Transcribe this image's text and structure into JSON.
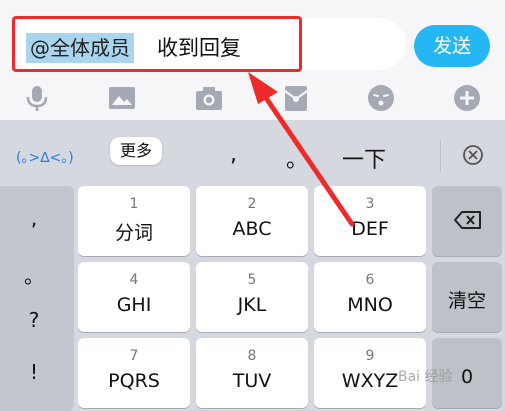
{
  "input": {
    "mention": "@全体成员",
    "text": "收到回复"
  },
  "send_button": {
    "label": "发送"
  },
  "toolbar_icons": [
    "microphone-icon",
    "image-icon",
    "camera-icon",
    "red-packet-icon",
    "emoji-icon",
    "plus-icon"
  ],
  "suggestion_bar": {
    "emoticon": "(｡>∆<｡)",
    "more_label": "更多",
    "candidates": [
      ",",
      "。",
      "一下"
    ]
  },
  "punctuation_keys": [
    ",",
    "。",
    "?",
    "!"
  ],
  "keys": [
    {
      "num": "1",
      "letters": "分词"
    },
    {
      "num": "2",
      "letters": "ABC"
    },
    {
      "num": "3",
      "letters": "DEF"
    },
    {
      "num": "4",
      "letters": "GHI"
    },
    {
      "num": "5",
      "letters": "JKL"
    },
    {
      "num": "6",
      "letters": "MNO"
    },
    {
      "num": "7",
      "letters": "PQRS"
    },
    {
      "num": "8",
      "letters": "TUV"
    },
    {
      "num": "9",
      "letters": "WXYZ"
    }
  ],
  "right_keys": {
    "clear_label": "清空",
    "zero_label": "0"
  },
  "watermark": "Bai 经验",
  "colors": {
    "send_blue": "#24b7f4",
    "highlight_red": "#ee2a2a",
    "mention_bg": "#a9d5ef"
  }
}
